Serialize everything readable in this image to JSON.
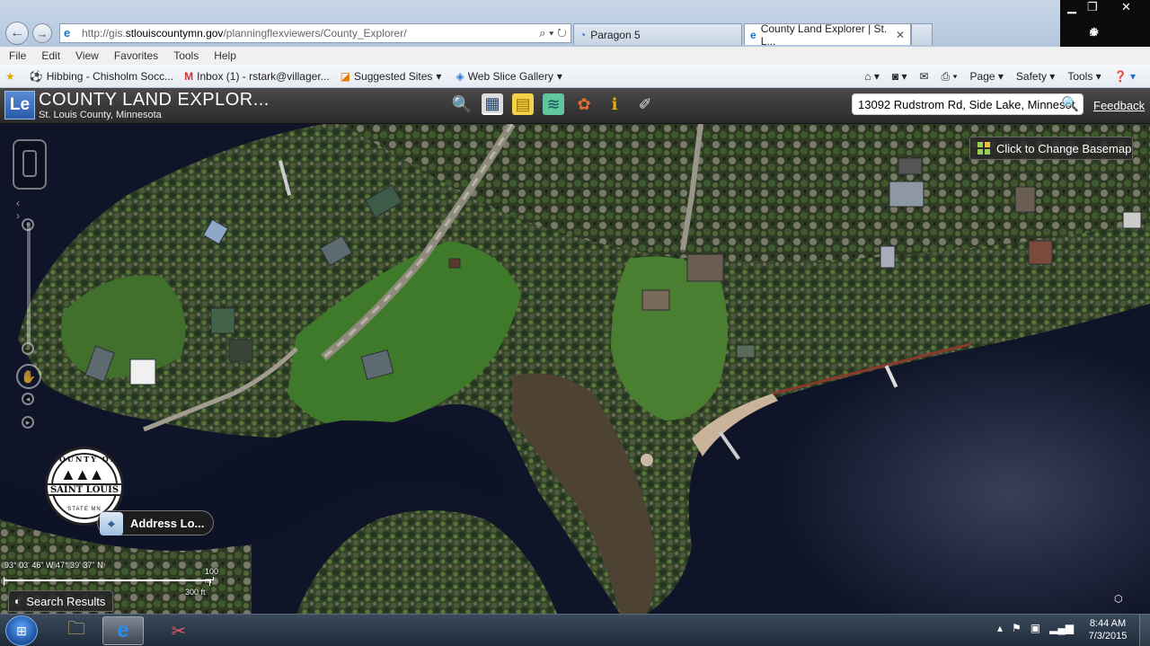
{
  "browser": {
    "url_prefix": "http://gis.",
    "url_host": "stlouiscountymn.gov",
    "url_path": "/planningflexviewers/County_Explorer/",
    "tabs": [
      {
        "label": "Paragon 5"
      },
      {
        "label": "County Land Explorer | St. L..."
      }
    ],
    "menu": [
      "File",
      "Edit",
      "View",
      "Favorites",
      "Tools",
      "Help"
    ],
    "favorites": [
      {
        "label": "Hibbing - Chisholm Socc..."
      },
      {
        "label": "Inbox (1) - rstark@villager..."
      },
      {
        "label": "Suggested Sites"
      },
      {
        "label": "Web Slice Gallery"
      }
    ],
    "commands": [
      "Page",
      "Safety",
      "Tools"
    ]
  },
  "app": {
    "logo": "Le",
    "title": "COUNTY  LAND  EXPLOR...",
    "subtitle": "St. Louis County, Minnesota",
    "search_value": "13092 Rudstrom Rd, Side Lake, Minnesot",
    "feedback": "Feedback",
    "tools": [
      "search-tool",
      "map-tool",
      "notes-tool",
      "layers-tool",
      "print-tool",
      "info-tool",
      "measure-tool"
    ]
  },
  "map": {
    "basemap_button": "Click to Change Basemap",
    "address_locator": "Address Lo...",
    "coordinates": "93° 03' 46\" W 47° 39' 37\" N",
    "scale_m": "100 m",
    "scale_ft": "300 ft",
    "search_results": "Search Results",
    "seal": {
      "top": "COUNTY OF",
      "name": "SAINT LOUIS",
      "bottom": "STATE MN"
    },
    "colors": {
      "water": "#101428",
      "forest": "#2e3f22",
      "grass": "#3f7a2a",
      "beach": "#c9b49a"
    }
  },
  "taskbar": {
    "time": "8:44 AM",
    "date": "7/3/2015"
  }
}
